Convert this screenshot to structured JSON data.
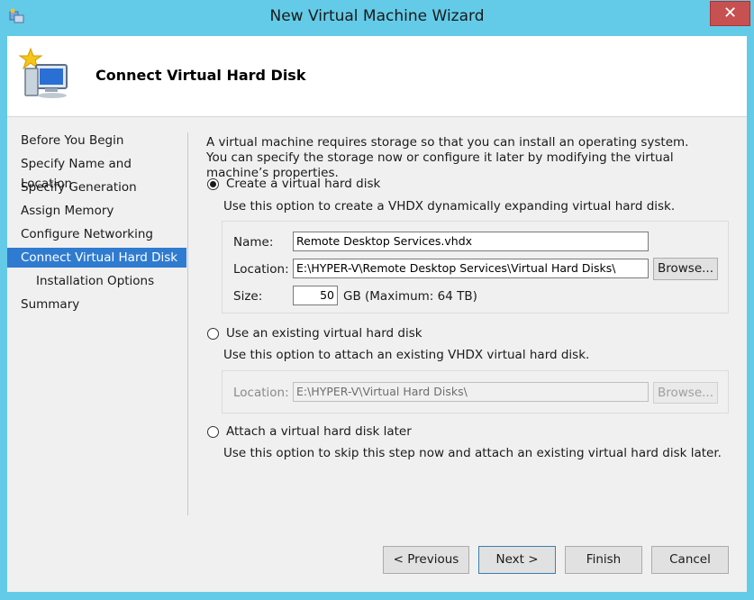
{
  "window": {
    "title": "New Virtual Machine Wizard",
    "close_glyph": "✕"
  },
  "header": {
    "title": "Connect Virtual Hard Disk",
    "icon": "wizard-computer-icon"
  },
  "nav": {
    "items": [
      {
        "label": "Before You Begin"
      },
      {
        "label": "Specify Name and Location"
      },
      {
        "label": "Specify Generation"
      },
      {
        "label": "Assign Memory"
      },
      {
        "label": "Configure Networking"
      },
      {
        "label": "Connect Virtual Hard Disk",
        "active": true
      },
      {
        "label": "Installation Options",
        "sub": true
      },
      {
        "label": "Summary"
      }
    ]
  },
  "content": {
    "intro": "A virtual machine requires storage so that you can install an operating system. You can specify the storage now or configure it later by modifying the virtual machine’s properties.",
    "option_create": {
      "label": "Create a virtual hard disk",
      "selected": true,
      "description": "Use this option to create a VHDX dynamically expanding virtual hard disk.",
      "name_label": "Name:",
      "name_value": "Remote Desktop Services.vhdx",
      "location_label": "Location:",
      "location_value": "E:\\HYPER-V\\Remote Desktop Services\\Virtual Hard Disks\\",
      "browse_label": "Browse...",
      "size_label": "Size:",
      "size_value": "50",
      "size_suffix": "GB (Maximum: 64 TB)"
    },
    "option_existing": {
      "label": "Use an existing virtual hard disk",
      "selected": false,
      "description": "Use this option to attach an existing VHDX virtual hard disk.",
      "location_label": "Location:",
      "location_value": "E:\\HYPER-V\\Virtual Hard Disks\\",
      "browse_label": "Browse..."
    },
    "option_later": {
      "label": "Attach a virtual hard disk later",
      "selected": false,
      "description": "Use this option to skip this step now and attach an existing virtual hard disk later."
    }
  },
  "footer": {
    "previous": "< Previous",
    "next": "Next >",
    "finish": "Finish",
    "cancel": "Cancel"
  },
  "colors": {
    "frame": "#63cbe8",
    "nav_active": "#2f7bd0",
    "close": "#c75050"
  }
}
